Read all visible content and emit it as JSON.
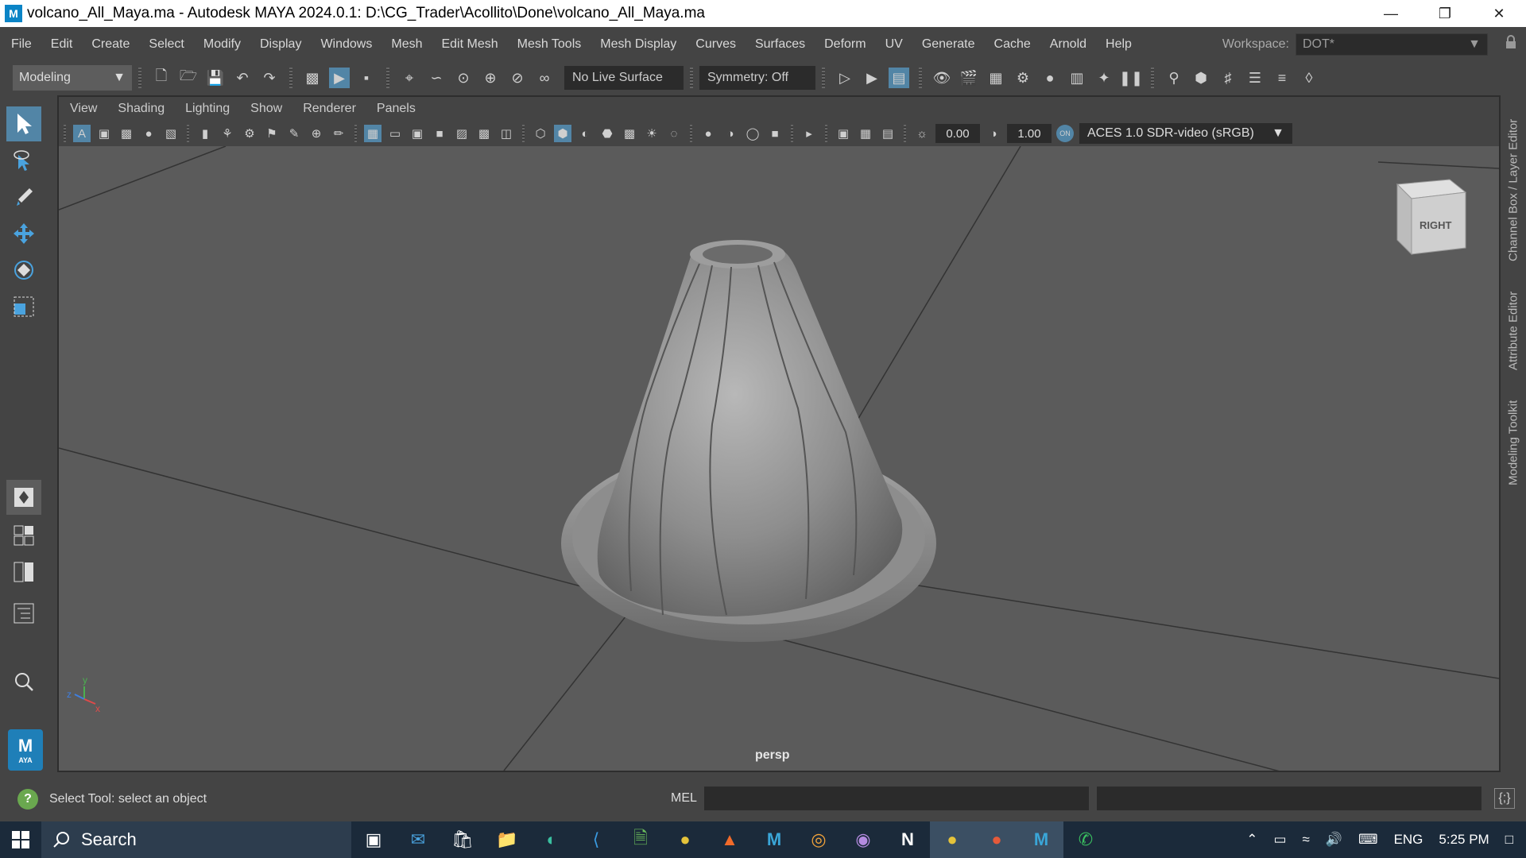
{
  "window": {
    "app_icon_letter": "M",
    "title": "volcano_All_Maya.ma - Autodesk MAYA 2024.0.1: D:\\CG_Trader\\Acollito\\Done\\volcano_All_Maya.ma",
    "controls": [
      "minimize-icon",
      "restore-icon",
      "close-icon"
    ]
  },
  "menubar": {
    "items": [
      "File",
      "Edit",
      "Create",
      "Select",
      "Modify",
      "Display",
      "Windows",
      "Mesh",
      "Edit Mesh",
      "Mesh Tools",
      "Mesh Display",
      "Curves",
      "Surfaces",
      "Deform",
      "UV",
      "Generate",
      "Cache",
      "Arnold",
      "Help"
    ],
    "workspace_label": "Workspace:",
    "workspace_value": "DOT*"
  },
  "shelf": {
    "mode": "Modeling",
    "live_surface": "No Live Surface",
    "symmetry": "Symmetry: Off"
  },
  "viewport": {
    "menu": [
      "View",
      "Shading",
      "Lighting",
      "Show",
      "Renderer",
      "Panels"
    ],
    "exposure": "0.00",
    "gamma": "1.00",
    "color_space": "ACES 1.0 SDR-video (sRGB)",
    "camera_label": "persp",
    "viewcube_label": "RIGHT",
    "axis_labels": {
      "x": "x",
      "y": "y",
      "z": "z"
    }
  },
  "right_tabs": [
    "Channel Box / Layer Editor",
    "Attribute Editor",
    "Modeling Toolkit"
  ],
  "status": {
    "help_text": "Select Tool: select an object",
    "mel_label": "MEL",
    "mel_value": ""
  },
  "taskbar": {
    "search_placeholder": "Search",
    "apps": [
      "task-view-icon",
      "mail-icon",
      "store-icon",
      "file-explorer-icon",
      "edge-icon",
      "vscode-icon",
      "notepad-icon",
      "chrome-icon",
      "brave-icon",
      "maya-m-icon",
      "blender-icon",
      "github-icon",
      "notion-icon",
      "chrome-icon",
      "chrome-icon",
      "maya-active-icon",
      "whatsapp-icon"
    ],
    "language": "ENG",
    "time": "5:25 PM"
  },
  "colors": {
    "accent": "#5285a6",
    "panel": "#444444",
    "viewport_bg": "#5b5b5b",
    "taskbar": "#1b2a3a"
  }
}
